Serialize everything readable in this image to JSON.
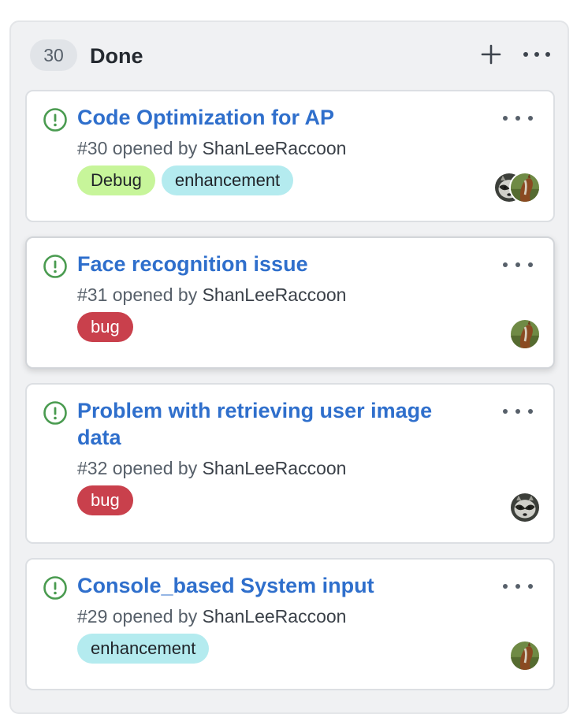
{
  "column": {
    "count": "30",
    "title": "Done",
    "add_icon": "plus-icon",
    "menu_icon": "kebab-horizontal-icon"
  },
  "colors": {
    "title_link": "#2f6fcc",
    "open_issue": "#4a9b50",
    "label_debug_bg": "#c7f59a",
    "label_enhancement_bg": "#b4ebef",
    "label_bug_bg": "#c9404c"
  },
  "cards": [
    {
      "title": "Code Optimization for AP",
      "number": "#30",
      "opened_by_text": "opened by",
      "author": "ShanLeeRaccoon",
      "labels": [
        {
          "name": "Debug",
          "bg": "#c7f59a",
          "fg": "#1f2328"
        },
        {
          "name": "enhancement",
          "bg": "#b4ebef",
          "fg": "#1f2328"
        }
      ],
      "assignees": [
        "raccoon-avatar",
        "horse-avatar"
      ]
    },
    {
      "title": "Face recognition issue",
      "number": "#31",
      "opened_by_text": "opened by",
      "author": "ShanLeeRaccoon",
      "labels": [
        {
          "name": "bug",
          "bg": "#c9404c",
          "fg": "#ffffff"
        }
      ],
      "assignees": [
        "horse-avatar"
      ]
    },
    {
      "title": "Problem with retrieving user image data",
      "number": "#32",
      "opened_by_text": "opened by",
      "author": "ShanLeeRaccoon",
      "labels": [
        {
          "name": "bug",
          "bg": "#c9404c",
          "fg": "#ffffff"
        }
      ],
      "assignees": [
        "raccoon-avatar"
      ]
    },
    {
      "title": "Console_based System input",
      "number": "#29",
      "opened_by_text": "opened by",
      "author": "ShanLeeRaccoon",
      "labels": [
        {
          "name": "enhancement",
          "bg": "#b4ebef",
          "fg": "#1f2328"
        }
      ],
      "assignees": [
        "horse-avatar"
      ]
    }
  ]
}
